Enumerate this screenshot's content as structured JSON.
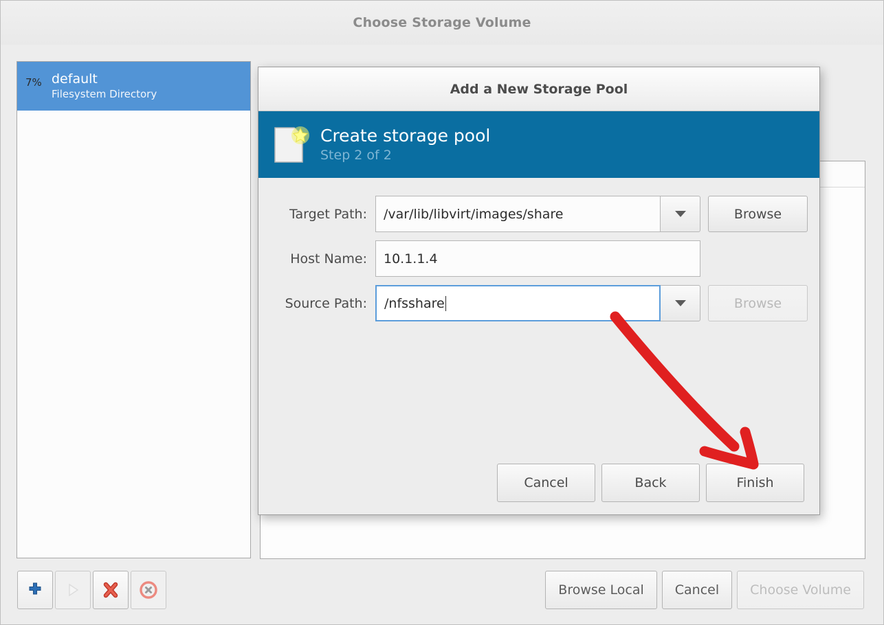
{
  "parent_window": {
    "title": "Choose Storage Volume",
    "pool_list": [
      {
        "percent": "7%",
        "name": "default",
        "type": "Filesystem Directory",
        "selected": true
      }
    ],
    "toolbar": [
      {
        "name": "add-pool-button",
        "icon": "plus-icon",
        "enabled": true
      },
      {
        "name": "start-pool-button",
        "icon": "play-icon",
        "enabled": false
      },
      {
        "name": "delete-pool-button",
        "icon": "red-x-icon",
        "enabled": true
      },
      {
        "name": "stop-pool-button",
        "icon": "stop-circle-icon",
        "enabled": true
      }
    ],
    "actions": [
      {
        "label": "Browse Local",
        "enabled": true
      },
      {
        "label": "Cancel",
        "enabled": true
      },
      {
        "label": "Choose Volume",
        "enabled": false
      }
    ]
  },
  "dialog": {
    "title": "Add a New Storage Pool",
    "banner": {
      "heading": "Create storage pool",
      "step": "Step 2 of 2",
      "icon": "new-document-star-icon",
      "background": "#0a6ea1"
    },
    "fields": [
      {
        "label": "Target Path:",
        "value": "/var/lib/libvirt/images/share",
        "has_dropdown": true,
        "browse_label": "Browse",
        "browse_enabled": true,
        "focused": false
      },
      {
        "label": "Host Name:",
        "value": "10.1.1.4",
        "has_dropdown": false,
        "browse_label": "",
        "browse_enabled": false,
        "focused": false
      },
      {
        "label": "Source Path:",
        "value": "/nfsshare",
        "has_dropdown": true,
        "browse_label": "Browse",
        "browse_enabled": false,
        "focused": true
      }
    ],
    "buttons": [
      {
        "label": "Cancel"
      },
      {
        "label": "Back"
      },
      {
        "label": "Finish"
      }
    ]
  },
  "annotation": {
    "type": "arrow",
    "color": "#e02020",
    "points_to": "Finish"
  }
}
